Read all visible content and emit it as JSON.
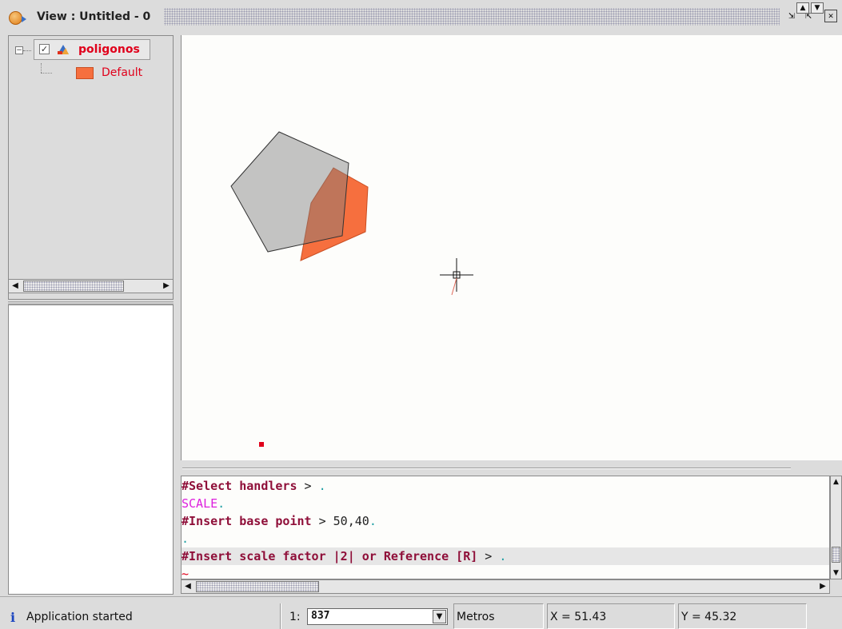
{
  "window": {
    "title": "View : Untitled - 0",
    "icons": {
      "app": "globe-icon",
      "iconify": "iconify-icon",
      "maximize": "maximize-icon",
      "close": "close-icon"
    },
    "glyphs": {
      "iconify": "⇲",
      "maximize": "⇱",
      "close": "✕"
    }
  },
  "toc": {
    "collapse_glyph": "−",
    "layer": {
      "name": "poligonos",
      "checked": true,
      "check_glyph": "✓",
      "icon": "polygon-layer-icon"
    },
    "legend": {
      "label": "Default",
      "swatch_color": "#f66f3e"
    }
  },
  "map": {
    "background": "#fdfdfb",
    "original_polygon": {
      "fill": "#f66f3e",
      "stroke": "#c94e22"
    },
    "scaled_preview_polygon": {
      "fill": "#7d7d7d",
      "opacity": 0.45,
      "stroke": "#333333"
    },
    "cursor": "crosshair-icon",
    "handler_color": "#e0001b"
  },
  "console": {
    "lines": [
      {
        "prompt": "#Select handlers",
        "gt": " > ",
        "value": "",
        "dot": "."
      },
      {
        "command": "SCALE",
        "dot": "."
      },
      {
        "prompt": "#Insert base point",
        "gt": " > ",
        "value": "50,40",
        "dot": "."
      },
      {
        "dot": "."
      },
      {
        "prompt": "#Insert scale factor |2| or Reference [R]",
        "gt": " > ",
        "value": "",
        "dot": "."
      },
      {
        "tilde": "~"
      }
    ],
    "arrows": {
      "up": "▲",
      "down": "▼",
      "left": "◀",
      "right": "▶"
    }
  },
  "statusbar": {
    "info_icon": "i",
    "message": "Application started",
    "scale_prefix": "1:",
    "scale_value": "837",
    "scale_arrow": "▼",
    "units": "Metros",
    "x": "X = 51.43",
    "y": "Y = 45.32"
  }
}
